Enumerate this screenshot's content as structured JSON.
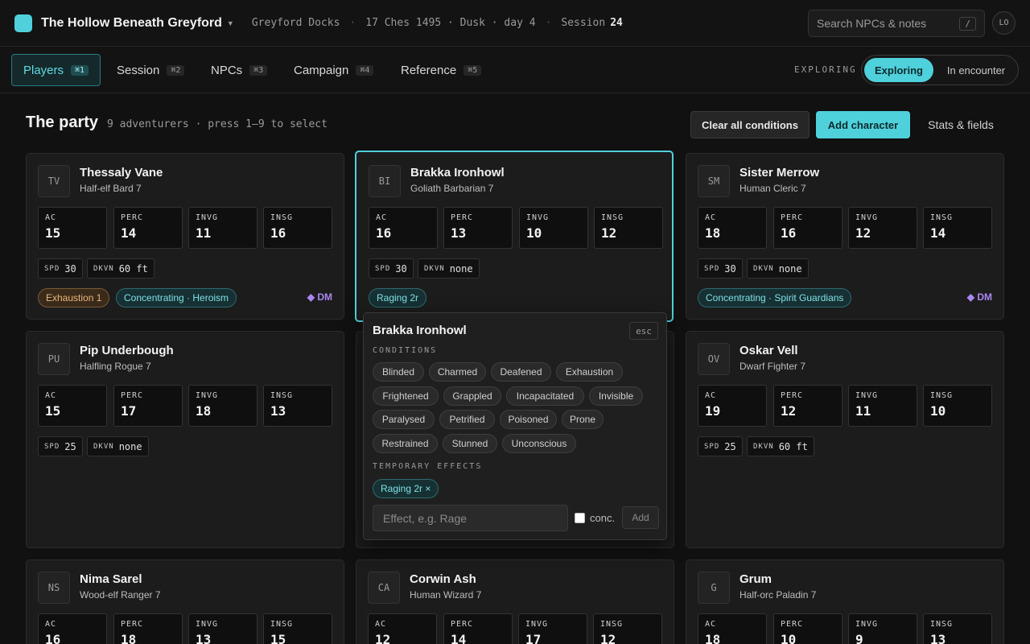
{
  "app": {
    "title": "The Hollow Beneath Greyford"
  },
  "breadcrumb": {
    "location": "Greyford Docks",
    "date": "17 Ches 1495 · Dusk · day 4",
    "session_label": "Session",
    "session_num": "24"
  },
  "search": {
    "placeholder": "Search NPCs & notes",
    "shortcut": "/"
  },
  "user": {
    "initials": "LO"
  },
  "tabs": [
    {
      "label": "Players",
      "key": "⌘1"
    },
    {
      "label": "Session",
      "key": "⌘2"
    },
    {
      "label": "NPCs",
      "key": "⌘3"
    },
    {
      "label": "Campaign",
      "key": "⌘4"
    },
    {
      "label": "Reference",
      "key": "⌘5"
    }
  ],
  "mode": {
    "label": "EXPLORING",
    "options": [
      "Exploring",
      "In encounter"
    ],
    "active": "Exploring"
  },
  "section": {
    "title": "The party",
    "subtitle": "9 adventurers · press 1–9 to select"
  },
  "actions": {
    "clear": "Clear all conditions",
    "add": "Add character",
    "stats": "Stats & fields"
  },
  "stat_labels": {
    "ac": "AC",
    "perc": "PERC",
    "invg": "INVG",
    "insg": "INSG",
    "spd": "SPD",
    "dkvn": "DKVN"
  },
  "characters": [
    {
      "initials": "TV",
      "name": "Thessaly Vane",
      "class": "Half-elf Bard 7",
      "ac": "15",
      "perc": "14",
      "invg": "11",
      "insg": "16",
      "spd": "30",
      "dkvn": "60 ft",
      "tags": [
        "Exhaustion 1",
        "Concentrating · Heroism"
      ],
      "dm": "◆ DM"
    },
    {
      "initials": "BI",
      "name": "Brakka Ironhowl",
      "class": "Goliath Barbarian 7",
      "ac": "16",
      "perc": "13",
      "invg": "10",
      "insg": "12",
      "spd": "30",
      "dkvn": "none",
      "tags": [
        "Raging 2r"
      ]
    },
    {
      "initials": "SM",
      "name": "Sister Merrow",
      "class": "Human Cleric 7",
      "ac": "18",
      "perc": "16",
      "invg": "12",
      "insg": "14",
      "spd": "30",
      "dkvn": "none",
      "tags": [
        "Concentrating · Spirit Guardians"
      ],
      "dm": "◆ DM"
    },
    {
      "initials": "PU",
      "name": "Pip Underbough",
      "class": "Halfling Rogue 7",
      "ac": "15",
      "perc": "17",
      "invg": "18",
      "insg": "13",
      "spd": "25",
      "dkvn": "none"
    },
    {
      "initials": "OV",
      "name": "Oskar Vell",
      "class": "Dwarf Fighter 7",
      "ac": "19",
      "perc": "12",
      "invg": "11",
      "insg": "10",
      "spd": "25",
      "dkvn": "60 ft"
    },
    {
      "initials": "NS",
      "name": "Nima Sarel",
      "class": "Wood-elf Ranger 7",
      "ac": "16",
      "perc": "18",
      "invg": "13",
      "insg": "15"
    },
    {
      "initials": "CA",
      "name": "Corwin Ash",
      "class": "Human Wizard 7",
      "ac": "12",
      "perc": "14",
      "invg": "17",
      "insg": "12"
    },
    {
      "initials": "G",
      "name": "Grum",
      "class": "Half-orc Paladin 7",
      "ac": "18",
      "perc": "10",
      "invg": "9",
      "insg": "13"
    }
  ],
  "popover": {
    "title": "Brakka Ironhowl",
    "esc": "esc",
    "conditions_label": "CONDITIONS",
    "conditions": [
      "Blinded",
      "Charmed",
      "Deafened",
      "Exhaustion",
      "Frightened",
      "Grappled",
      "Incapacitated",
      "Invisible",
      "Paralysed",
      "Petrified",
      "Poisoned",
      "Prone",
      "Restrained",
      "Stunned",
      "Unconscious"
    ],
    "effects_label": "TEMPORARY EFFECTS",
    "effect_tag": "Raging 2r ×",
    "effect_placeholder": "Effect, e.g. Rage",
    "conc_label": "conc.",
    "add_label": "Add"
  },
  "colors": {
    "accent": "#4fd1dc",
    "dm": "#a986f0",
    "exhaustion": "#e8b77a"
  }
}
